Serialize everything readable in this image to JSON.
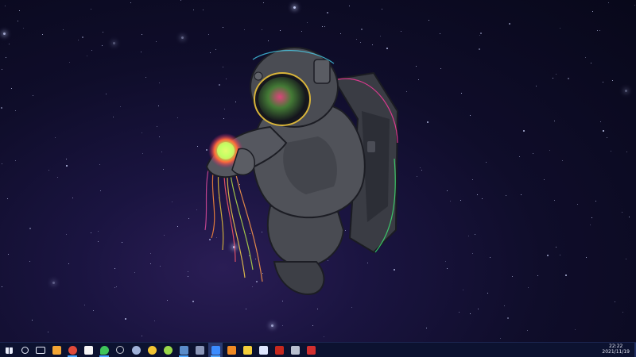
{
  "desktop": {
    "wallpaper": "astronaut-space-wallpaper",
    "colors": {
      "bg_dark": "#08081a",
      "nebula": "#2a1d55"
    }
  },
  "taskbar": {
    "icons": [
      {
        "name": "windows-start-icon",
        "color": "#e9eefc"
      },
      {
        "name": "search-icon",
        "color": "#e9eefc"
      },
      {
        "name": "task-view-icon",
        "color": "#e9eefc"
      },
      {
        "name": "file-explorer-icon",
        "color": "#f2a534"
      },
      {
        "name": "chrome-icon",
        "color": "#e04a3a"
      },
      {
        "name": "qq-icon",
        "color": "#f5f5f5"
      },
      {
        "name": "wechat-icon",
        "color": "#3ec55a"
      },
      {
        "name": "settings-gear-icon",
        "color": "#c8cbd4"
      },
      {
        "name": "sphere-app-icon",
        "color": "#9fb1d8"
      },
      {
        "name": "yellow-face-app-icon",
        "color": "#f2c433"
      },
      {
        "name": "green-smiley-app-icon",
        "color": "#9ad84a"
      },
      {
        "name": "steam-icon",
        "color": "#5a8cc9"
      },
      {
        "name": "generic-app-icon",
        "color": "#8a96b8"
      },
      {
        "name": "media-player-icon",
        "color": "#3b8cff"
      },
      {
        "name": "orange-app-icon",
        "color": "#f08a24"
      },
      {
        "name": "sticky-notes-icon",
        "color": "#f4cf3b"
      },
      {
        "name": "dock-app-icon",
        "color": "#dfe6ff"
      },
      {
        "name": "filezilla-icon",
        "color": "#c6281e"
      },
      {
        "name": "game-controller-icon",
        "color": "#b9c0d0"
      },
      {
        "name": "wps-icon",
        "color": "#d22f2f"
      }
    ],
    "clock": {
      "time": "22:22",
      "date": "2021/11/19"
    }
  }
}
